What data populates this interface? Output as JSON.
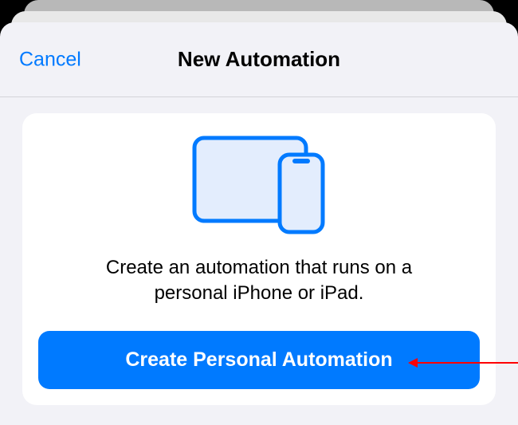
{
  "header": {
    "cancel_label": "Cancel",
    "title": "New Automation"
  },
  "card": {
    "description": "Create an automation that runs on a personal iPhone or iPad.",
    "button_label": "Create Personal Automation"
  }
}
